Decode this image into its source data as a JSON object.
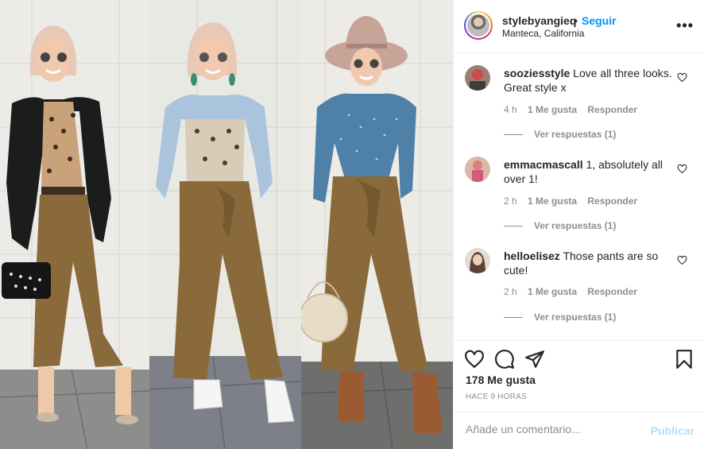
{
  "post": {
    "username": "stylebyangieq",
    "separator": "•",
    "follow_label": "Seguir",
    "location": "Manteca, California",
    "more_label": "•••"
  },
  "comments": [
    {
      "username": "sooziesstyle",
      "text": "Love all three looks. Great style x",
      "age": "4 h",
      "likes": "1 Me gusta",
      "reply": "Responder",
      "view_replies": "Ver respuestas (1)"
    },
    {
      "username": "emmacmascall",
      "text": "1, absolutely all over 1!",
      "age": "2 h",
      "likes": "1 Me gusta",
      "reply": "Responder",
      "view_replies": "Ver respuestas (1)"
    },
    {
      "username": "helloelisez",
      "text": "Those pants are so cute!",
      "age": "2 h",
      "likes": "1 Me gusta",
      "reply": "Responder",
      "view_replies": "Ver respuestas (1)"
    }
  ],
  "actions": {
    "like_icon": "heart-outline",
    "comment_icon": "speech-bubble",
    "share_icon": "paper-plane",
    "save_icon": "bookmark"
  },
  "likes_count": "178 Me gusta",
  "time_ago": "HACE 9 HORAS",
  "add_comment": {
    "placeholder": "Añade un comentario...",
    "publish_label": "Publicar"
  },
  "colors": {
    "accent": "#0095f6",
    "publish_disabled": "#b2dffc",
    "muted": "#8e8e8e",
    "pants": "#8a6a3b"
  }
}
